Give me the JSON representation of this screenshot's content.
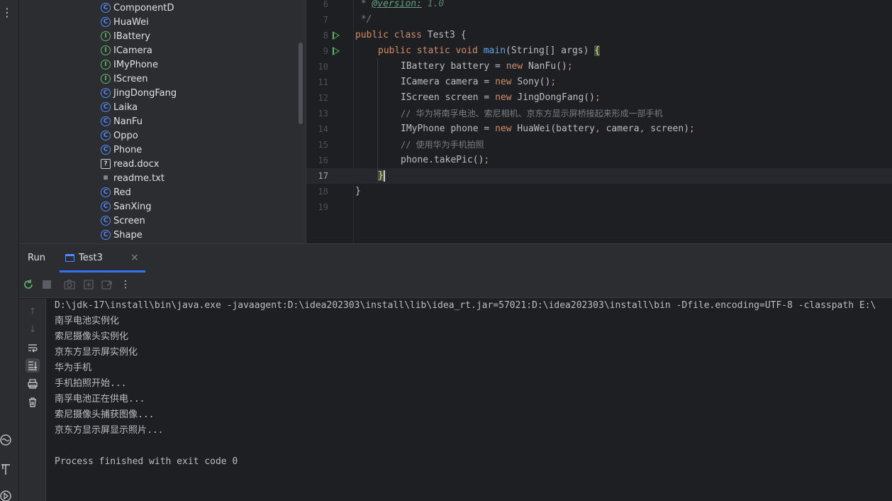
{
  "project_tree": {
    "items": [
      {
        "name": "ComponentD",
        "kind": "class"
      },
      {
        "name": "HuaWei",
        "kind": "class"
      },
      {
        "name": "IBattery",
        "kind": "interface"
      },
      {
        "name": "ICamera",
        "kind": "interface"
      },
      {
        "name": "IMyPhone",
        "kind": "interface"
      },
      {
        "name": "IScreen",
        "kind": "interface"
      },
      {
        "name": "JingDongFang",
        "kind": "class"
      },
      {
        "name": "Laika",
        "kind": "class"
      },
      {
        "name": "NanFu",
        "kind": "class"
      },
      {
        "name": "Oppo",
        "kind": "class"
      },
      {
        "name": "Phone",
        "kind": "class"
      },
      {
        "name": "read.docx",
        "kind": "unknown-file"
      },
      {
        "name": "readme.txt",
        "kind": "text-file"
      },
      {
        "name": "Red",
        "kind": "class"
      },
      {
        "name": "SanXing",
        "kind": "class"
      },
      {
        "name": "Screen",
        "kind": "class"
      },
      {
        "name": "Shape",
        "kind": "class"
      }
    ]
  },
  "editor": {
    "line_numbers": [
      "6",
      "7",
      "8",
      "9",
      "10",
      "11",
      "12",
      "13",
      "14",
      "15",
      "16",
      "17",
      "18",
      "19"
    ],
    "current_line": "17",
    "code": {
      "l6_star": " * ",
      "l6_tag": "@version:",
      "l6_val": " 1.0",
      "l7": " */",
      "l8_kw": "public class",
      "l8_rest": " Test3 {",
      "l9_kw": "public static void",
      "l9_fn": "main",
      "l9_rest": "(String[] args) ",
      "l9_brace": "{",
      "l10_a": "IBattery battery = ",
      "l10_kw": "new",
      "l10_b": " NanFu()",
      "l10_semi": ";",
      "l11_a": "ICamera camera = ",
      "l11_kw": "new",
      "l11_b": " Sony()",
      "l11_semi": ";",
      "l12_a": "IScreen screen = ",
      "l12_kw": "new",
      "l12_b": " JingDongFang()",
      "l12_semi": ";",
      "l13": "// 华为将南孚电池、索尼相机、京东方显示屏桥接起来形成一部手机",
      "l14_a": "IMyPhone phone = ",
      "l14_kw": "new",
      "l14_b": " HuaWei(battery",
      "l14_c1": ",",
      "l14_d": " camera",
      "l14_c2": ",",
      "l14_e": " screen)",
      "l14_semi": ";",
      "l15": "// 使用华为手机拍照",
      "l16_a": "phone.takePic()",
      "l16_semi": ";",
      "l17": "}",
      "l18": "}"
    }
  },
  "run_panel": {
    "title": "Run",
    "tab_label": "Test3",
    "tab_close": "×",
    "console_lines": [
      "D:\\jdk-17\\install\\bin\\java.exe -javaagent:D:\\idea202303\\install\\lib\\idea_rt.jar=57021:D:\\idea202303\\install\\bin -Dfile.encoding=UTF-8 -classpath E:\\",
      "南孚电池实例化",
      "索尼摄像头实例化",
      "京东方显示屏实例化",
      "华为手机",
      "手机拍照开始...",
      "南孚电池正在供电...",
      "索尼摄像头捕获图像...",
      "京东方显示屏显示照片...",
      "",
      "Process finished with exit code 0"
    ]
  },
  "colors": {
    "background": "#1e1f22",
    "panel": "#2b2d30",
    "accent": "#3574f0",
    "keyword": "#cf8e6d",
    "function": "#56a8f5",
    "run_green": "#5fb865"
  }
}
